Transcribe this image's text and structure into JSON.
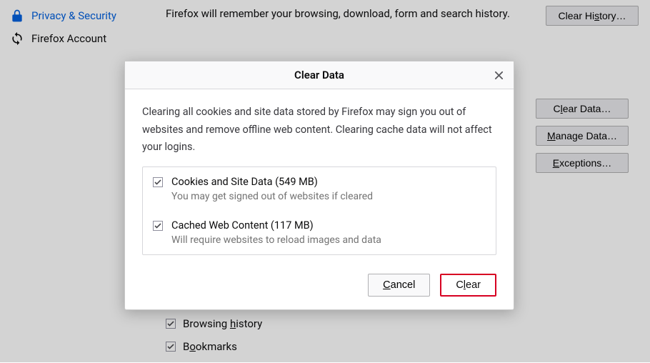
{
  "sidebar": {
    "items": [
      {
        "label": "Privacy & Security",
        "icon": "lock-icon",
        "active": true
      },
      {
        "label": "Firefox Account",
        "icon": "sync-icon",
        "active": false
      }
    ]
  },
  "content": {
    "history_desc": "Firefox will remember your browsing, download, form and search history.",
    "clear_history_btn_pre": "Clear Hi",
    "clear_history_btn_ul": "s",
    "clear_history_btn_post": "tory…"
  },
  "right_buttons": {
    "clear_data_pre": "C",
    "clear_data_ul": "l",
    "clear_data_post": "ear Data…",
    "manage_data_ul": "M",
    "manage_data_post": "anage Data…",
    "exceptions_ul": "E",
    "exceptions_post": "xceptions…"
  },
  "lower": {
    "browsing_pre": "Browsing ",
    "browsing_ul": "h",
    "browsing_post": "istory",
    "bookmarks_pre": "B",
    "bookmarks_ul": "o",
    "bookmarks_post": "okmarks"
  },
  "dialog": {
    "title": "Clear Data",
    "desc": "Clearing all cookies and site data stored by Firefox may sign you out of websites and remove offline web content. Clearing cache data will not affect your logins.",
    "options": [
      {
        "title": "Cookies and Site Data (549 MB)",
        "sub": "You may get signed out of websites if cleared",
        "checked": true
      },
      {
        "title": "Cached Web Content (117 MB)",
        "sub": "Will require websites to reload images and data",
        "checked": true
      }
    ],
    "cancel_ul": "C",
    "cancel_post": "ancel",
    "clear_pre": "C",
    "clear_ul": "l",
    "clear_post": "ear"
  }
}
